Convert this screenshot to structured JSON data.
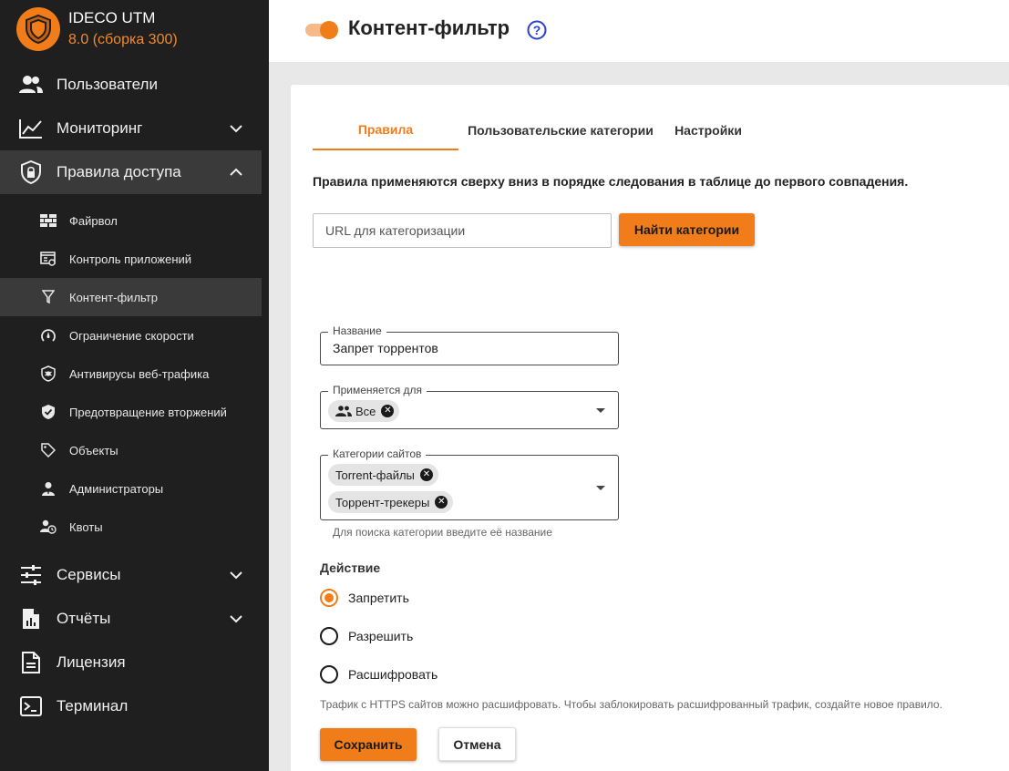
{
  "brand": {
    "name": "IDECO UTM",
    "version": "8.0 (сборка 300)"
  },
  "nav": {
    "users": "Пользователи",
    "monitoring": "Мониторинг",
    "access_rules": "Правила доступа",
    "sub": {
      "firewall": "Файрвол",
      "app_control": "Контроль приложений",
      "content_filter": "Контент-фильтр",
      "speed_limit": "Ограничение скорости",
      "antivirus": "Антивирусы веб-трафика",
      "ips": "Предотвращение вторжений",
      "objects": "Объекты",
      "admins": "Администраторы",
      "quotas": "Квоты"
    },
    "services": "Сервисы",
    "reports": "Отчёты",
    "license": "Лицензия",
    "terminal": "Терминал"
  },
  "header": {
    "title": "Контент-фильтр",
    "enabled": true
  },
  "tabs": [
    "Правила",
    "Пользовательские категории",
    "Настройки"
  ],
  "rules_note": "Правила применяются сверху вниз в порядке следования в таблице до первого совпадения.",
  "search": {
    "placeholder": "URL для категоризации",
    "button": "Найти категории"
  },
  "form": {
    "name_label": "Название",
    "name_value": "Запрет торрентов",
    "applies_label": "Применяется для",
    "applies_chip": "Все",
    "categories_label": "Категории сайтов",
    "categories": [
      "Torrent-файлы",
      "Торрент-трекеры"
    ],
    "categories_hint": "Для поиска категории введите её название",
    "action_title": "Действие",
    "actions": [
      "Запретить",
      "Разрешить",
      "Расшифровать"
    ],
    "selected_action": "Запретить",
    "https_hint": "Трафик с HTTPS сайтов можно расшифровать. Чтобы заблокировать расшифрованный трафик, создайте новое правило.",
    "save": "Сохранить",
    "cancel": "Отмена"
  },
  "colors": {
    "accent": "#f07d1a",
    "sidebar": "#1f1f1f"
  }
}
